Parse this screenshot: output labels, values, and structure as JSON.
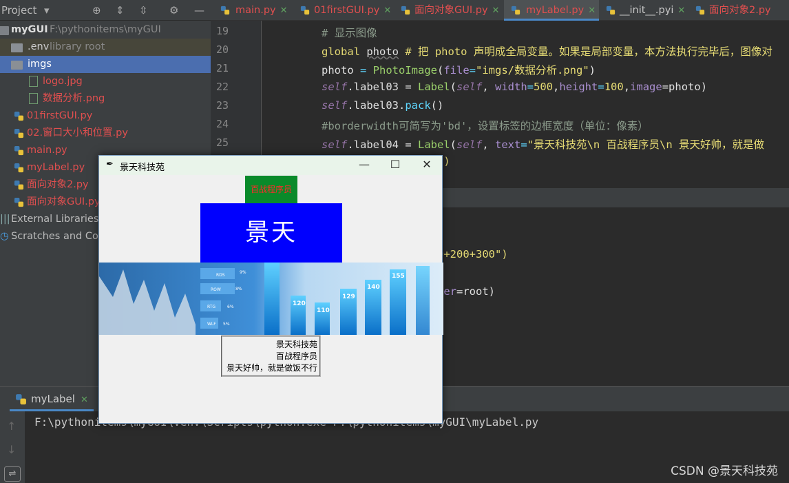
{
  "project_panel": {
    "title": "Project",
    "tree": [
      {
        "label": "myGUI",
        "extra": "F:\\pythonitems\\myGUI",
        "kind": "folder-root"
      },
      {
        "label": ".env",
        "extra": "library root",
        "kind": "folder"
      },
      {
        "label": "imgs",
        "extra": "",
        "kind": "folder"
      },
      {
        "label": "logo.jpg",
        "extra": "",
        "kind": "image"
      },
      {
        "label": "数据分析.png",
        "extra": "",
        "kind": "image"
      },
      {
        "label": "01firstGUI.py",
        "extra": "",
        "kind": "py"
      },
      {
        "label": "02.窗口大小和位置.py",
        "extra": "",
        "kind": "py"
      },
      {
        "label": "main.py",
        "extra": "",
        "kind": "py"
      },
      {
        "label": "myLabel.py",
        "extra": "",
        "kind": "py"
      },
      {
        "label": "面向对象2.py",
        "extra": "",
        "kind": "py"
      },
      {
        "label": "面向对象GUI.py",
        "extra": "",
        "kind": "py"
      },
      {
        "label": "External Libraries",
        "extra": "",
        "kind": "lib"
      },
      {
        "label": "Scratches and Cons",
        "extra": "",
        "kind": "scratch"
      }
    ]
  },
  "editor_tabs": [
    {
      "label": "main.py",
      "active": false
    },
    {
      "label": "01firstGUI.py",
      "active": false
    },
    {
      "label": "面向对象GUI.py",
      "active": false
    },
    {
      "label": "myLabel.py",
      "active": true
    },
    {
      "label": "__init__.pyi",
      "active": false
    },
    {
      "label": "面向对象2.py",
      "active": false
    }
  ],
  "line_numbers": [
    "19",
    "20",
    "21",
    "22",
    "23",
    "24",
    "25"
  ],
  "code_fragments": {
    "l19": "# 显示图像",
    "l20a": "global",
    "l20b": "photo",
    "l20c": "# 把 photo 声明成全局变量。如果是局部变量，本方法执行完毕后，图像对",
    "l21a": "photo",
    "l21b": " = ",
    "l21c": "PhotoImage",
    "l21d": "(",
    "l21e": "file",
    "l21f": "=",
    "l21g": "\"imgs/数据分析.png\"",
    "l21h": ")",
    "l22a": "self",
    "l22b": ".label03 = ",
    "l22c": "Label",
    "l22d": "(",
    "l22e": "self",
    "l22f": ", ",
    "l22g": "width",
    "l22h": "=",
    "l22i": "500",
    "l22j": ",",
    "l22k": "height",
    "l22l": "=",
    "l22m": "100",
    "l22n": ",",
    "l22o": "image",
    "l22p": "=photo)",
    "l23a": "self",
    "l23b": ".label03.",
    "l23c": "pack",
    "l23d": "()",
    "l24": "#borderwidth可简写为'bd'，设置标签的边框宽度（单位：像素）",
    "l25a": "self",
    "l25b": ".label04 = ",
    "l25c": "Label",
    "l25d": "(",
    "l25e": "self",
    "l25f": ", ",
    "l25g": "text",
    "l25h": "=",
    "l25i": "\"景天科技苑\\n 百战程序员\\n 景天好帅，就是做",
    "l26": "()",
    "l28": "0+200+300\")",
    "l30a": "ter",
    "l30b": "=root)"
  },
  "run_panel": {
    "tab_label": "myLabel",
    "command": "F:\\pythonitems\\myGUI\\venv\\Scripts\\python.exe F:\\pythonitems\\myGUI\\myLabel.py"
  },
  "tk_window": {
    "title": "景天科技苑",
    "minimize": "—",
    "maximize": "☐",
    "close": "✕",
    "label01": "百战程序员",
    "label02": "景天",
    "label04_lines": [
      "景天科技苑",
      "百战程序员",
      "景天好帅，就是做饭不行"
    ],
    "chart_image": {
      "bar_labels": [
        "120",
        "110",
        "129",
        "140",
        "155"
      ],
      "row_labels": [
        "RDS",
        "ROW",
        "RTG",
        "WLF"
      ],
      "row_pcts": [
        "9%",
        "8%",
        "6%",
        "5%"
      ]
    }
  },
  "watermark": "CSDN @景天科技苑",
  "colors": {
    "accent": "#4a88c7",
    "error_file": "#e04f4f",
    "arrow": "#e8322e"
  }
}
